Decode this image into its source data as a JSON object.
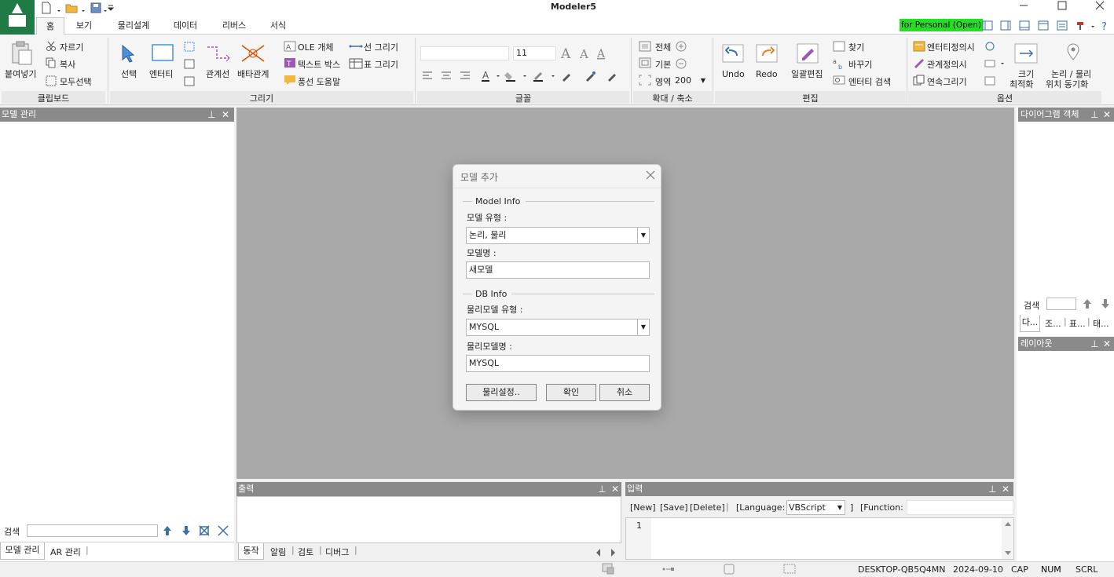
{
  "app": {
    "title": "Modeler5",
    "license_badge": "for Personal (Open)"
  },
  "colors": {
    "accent": "#1f7a45",
    "license_bg": "#22e022",
    "panel_header": "#8a8a8a",
    "canvas": "#a9a9a9"
  },
  "tabs": [
    {
      "label": "홈",
      "active": true
    },
    {
      "label": "보기"
    },
    {
      "label": "물리설계"
    },
    {
      "label": "데이터"
    },
    {
      "label": "리버스"
    },
    {
      "label": "서식"
    }
  ],
  "ribbon": {
    "clipboard": {
      "paste": "붙여넣기",
      "cut": "자르기",
      "copy": "복사",
      "select_all": "모두선택",
      "title": "클립보드"
    },
    "draw": {
      "select": "선택",
      "entity": "엔터티",
      "relation_line": "관계선",
      "exclusive_rel": "배타관계",
      "ole": "OLE 개체",
      "textbox": "텍스트 박스",
      "balloon": "풍선 도움말",
      "line_draw": "선 그리기",
      "table_draw": "표 그리기",
      "title": "그리기"
    },
    "font": {
      "size": "11",
      "title": "글꼴"
    },
    "zoom": {
      "full": "전체",
      "default": "기본",
      "area": "영역",
      "value": "200",
      "title": "확대 / 축소"
    },
    "edit": {
      "undo": "Undo",
      "redo": "Redo",
      "batch_edit": "일괄편집",
      "find": "찾기",
      "replace": "바꾸기",
      "entity_search": "엔터티 검색",
      "title": "편집"
    },
    "options": {
      "entity_def": "엔터티정의시",
      "relation_def": "관계정의시",
      "continuous": "연속그리기",
      "maximize_1": "크기",
      "maximize_2": "최적화",
      "sync_1": "논리 / 물리",
      "sync_2": "위치 동기화",
      "title": "옵션"
    }
  },
  "left_panel": {
    "title": "모델 관리",
    "search_label": "검색",
    "tabs": [
      "모델 관리",
      "AR 관리"
    ]
  },
  "right_panel": {
    "title": "다이어그램 객체",
    "search_label": "검색",
    "tabs": [
      "다...",
      "조...",
      "표...",
      "태..."
    ],
    "layout_title": "레이아웃"
  },
  "dialog": {
    "title": "모델 추가",
    "model_info_legend": "Model Info",
    "model_type_label": "모델 유형 :",
    "model_type_value": "논리, 물리",
    "model_name_label": "모델명 :",
    "model_name_value": "새모델",
    "db_info_legend": "DB Info",
    "phys_type_label": "물리모델 유형 :",
    "phys_type_value": "MYSQL",
    "phys_name_label": "물리모델명 :",
    "phys_name_value": "MYSQL",
    "btn_phys_settings": "물리설정..",
    "btn_ok": "확인",
    "btn_cancel": "취소"
  },
  "output_panel": {
    "title": "출력",
    "tabs": [
      "동작",
      "알림",
      "검토",
      "디버그"
    ]
  },
  "input_panel": {
    "title": "입력",
    "new": "[New]",
    "save": "[Save]",
    "delete": "[Delete]",
    "language_label": "[Language:",
    "language_value": "VBScript",
    "bracket_close": "]",
    "function_label": "[Function:",
    "line_number": "1"
  },
  "status": {
    "computer": "DESKTOP-QB5Q4MN",
    "date": "2024-09-10",
    "cap": "CAP",
    "num": "NUM",
    "scrl": "SCRL"
  }
}
